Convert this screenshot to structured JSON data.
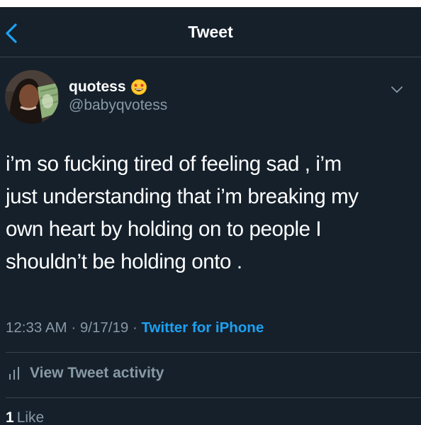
{
  "header": {
    "title": "Tweet"
  },
  "author": {
    "display_name": "quotess",
    "handle": "@babyqvotess",
    "badge_icon": "star-struck-emoji-icon"
  },
  "tweet": {
    "lines": [
      "i’m so fucking tired of feeling sad , i’m",
      "just understanding that i’m breaking my",
      "own heart by holding on to people I",
      "shouldn’t be holding onto ."
    ]
  },
  "meta": {
    "time": "12:33 AM",
    "date": "9/17/19",
    "separator": "·",
    "source": "Twitter for iPhone"
  },
  "activity": {
    "label": "View Tweet activity"
  },
  "stats": {
    "likes_count": "1",
    "likes_label": "Like"
  },
  "colors": {
    "background": "#15202b",
    "accent": "#1da1f2",
    "secondary_text": "#8899a6",
    "divider": "#38444d"
  }
}
